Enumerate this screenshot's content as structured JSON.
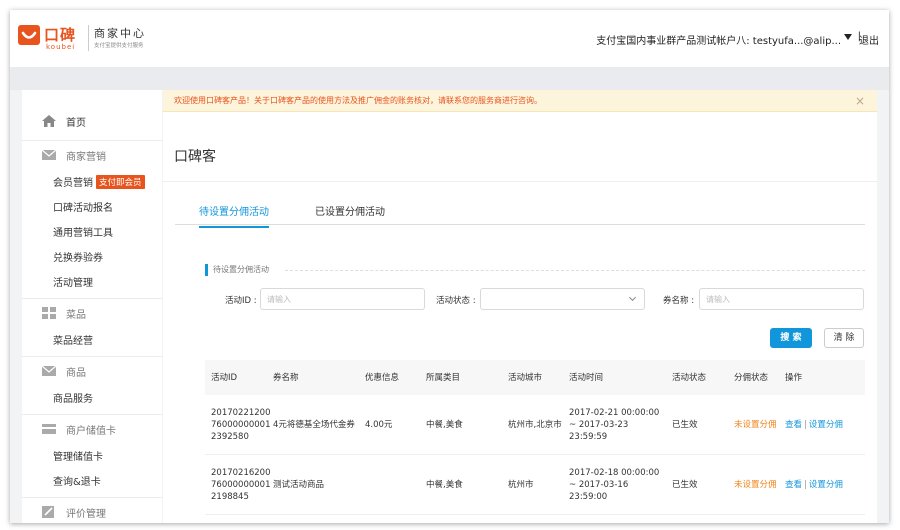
{
  "header": {
    "logo_text": "口碑",
    "logo_sub": "koubei",
    "center_title": "商家中心",
    "center_sub": "支付宝提供支付服务",
    "account": "支付宝国内事业群产品测试帐户八: testyufa...@alip...",
    "separator": "|",
    "logout": "退出"
  },
  "sidebar": {
    "home": "首页",
    "groups": [
      {
        "title": "商家营销",
        "items": [
          "会员营销",
          "口碑活动报名",
          "通用营销工具",
          "兑换券验券",
          "活动管理"
        ],
        "badge": "支付即会员"
      },
      {
        "title": "菜品",
        "items": [
          "菜品经营"
        ]
      },
      {
        "title": "商品",
        "items": [
          "商品服务"
        ]
      },
      {
        "title": "商户储值卡",
        "items": [
          "管理储值卡",
          "查询&退卡"
        ]
      },
      {
        "title": "评价管理",
        "items": []
      }
    ]
  },
  "notice": {
    "text": "欢迎使用口碑客产品！关于口碑客产品的使用方法及推广佣金的账务核对，请联系您的服务商进行咨询。",
    "close": "×"
  },
  "page": {
    "title": "口碑客",
    "tabs": [
      "待设置分佣活动",
      "已设置分佣活动"
    ],
    "active_tab": 0,
    "section_label": "待设置分佣活动"
  },
  "filters": {
    "activity_id_label": "活动ID :",
    "activity_id_placeholder": "请输入",
    "status_label": "活动状态 :",
    "status_value": "",
    "coupon_label": "券名称 :",
    "coupon_placeholder": "请输入",
    "search_button": "搜 索",
    "clear_button": "清 除"
  },
  "table": {
    "headers": [
      "活动ID",
      "券名称",
      "优惠信息",
      "所属类目",
      "活动城市",
      "活动时间",
      "活动状态",
      "分佣状态",
      "操作"
    ],
    "rows": [
      {
        "id": "20170221200760000000012392580",
        "name": "4元将德基全场代金券",
        "discount": "4.00元",
        "category": "中餐,美食",
        "city": "杭州市,北京市",
        "time": "2017-02-21 00:00:00 ~ 2017-03-23 23:59:59",
        "status": "已生效",
        "commission": "未设置分佣",
        "op_view": "查看",
        "op_set": "设置分佣"
      },
      {
        "id": "20170216200760000000012198845",
        "name": "测试活动商品",
        "discount": "",
        "category": "中餐,美食",
        "city": "杭州市",
        "time": "2017-02-18 00:00:00 ~ 2017-03-16 23:59:00",
        "status": "已生效",
        "commission": "未设置分佣",
        "op_view": "查看",
        "op_set": "设置分佣"
      }
    ]
  },
  "colors": {
    "brand_orange": "#e8541e",
    "primary_blue": "#1296db",
    "warning_orange": "#f08519"
  }
}
